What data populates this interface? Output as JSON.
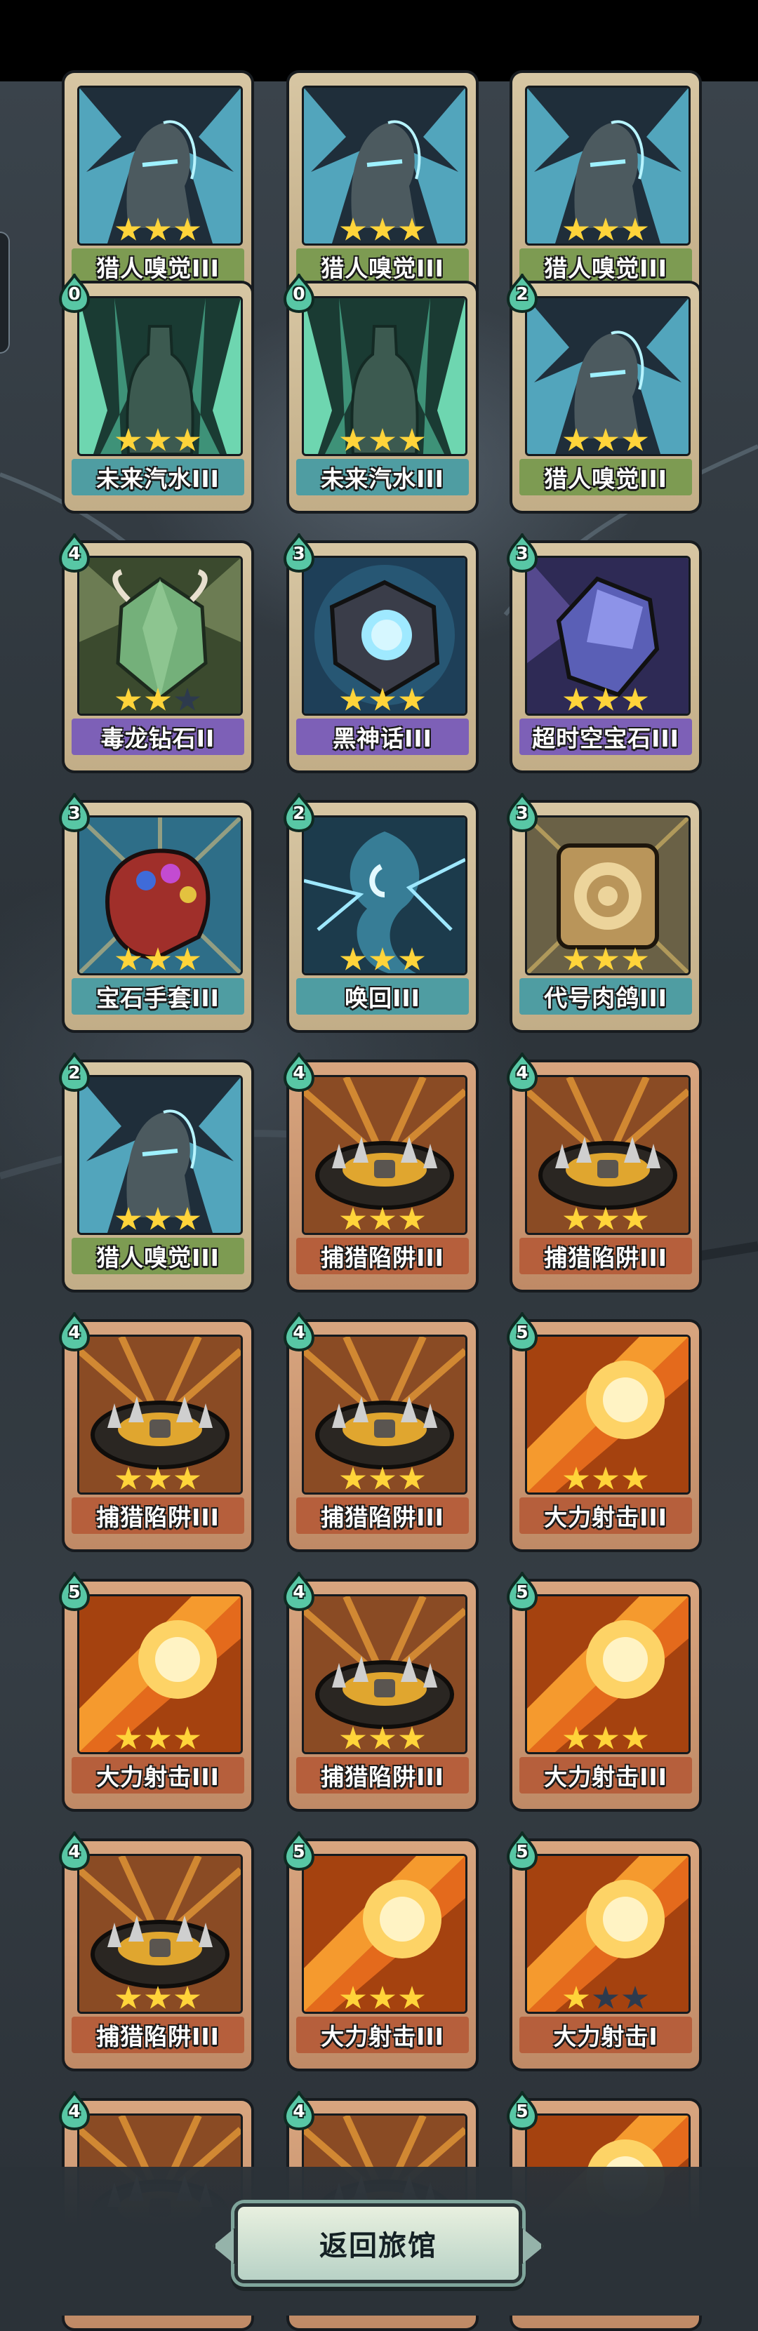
{
  "return_button": {
    "label": "返回旅馆"
  },
  "cards": [
    {
      "name": "猎人嗅觉III",
      "cost": null,
      "stars": 3,
      "theme": "green",
      "art": "hunter-icon"
    },
    {
      "name": "猎人嗅觉III",
      "cost": null,
      "stars": 3,
      "theme": "green",
      "art": "hunter-icon"
    },
    {
      "name": "猎人嗅觉III",
      "cost": null,
      "stars": 3,
      "theme": "green",
      "art": "hunter-icon"
    },
    {
      "name": "未来汽水III",
      "cost": "0",
      "stars": 3,
      "theme": "teal",
      "art": "soda-icon"
    },
    {
      "name": "未来汽水III",
      "cost": "0",
      "stars": 3,
      "theme": "teal",
      "art": "soda-icon"
    },
    {
      "name": "猎人嗅觉III",
      "cost": "2",
      "stars": 3,
      "theme": "green",
      "art": "hunter-icon"
    },
    {
      "name": "毒龙钻石II",
      "cost": "4",
      "stars": 2,
      "theme": "purple",
      "art": "dragon-gem-icon"
    },
    {
      "name": "黑神话III",
      "cost": "3",
      "stars": 3,
      "theme": "purple",
      "art": "black-myth-icon"
    },
    {
      "name": "超时空宝石III",
      "cost": "3",
      "stars": 3,
      "theme": "purple",
      "art": "time-gem-icon"
    },
    {
      "name": "宝石手套III",
      "cost": "3",
      "stars": 3,
      "theme": "teal",
      "art": "gauntlet-icon"
    },
    {
      "name": "唤回III",
      "cost": "2",
      "stars": 3,
      "theme": "teal",
      "art": "recall-icon"
    },
    {
      "name": "代号肉鸽III",
      "cost": "3",
      "stars": 3,
      "theme": "teal",
      "art": "codename-icon"
    },
    {
      "name": "猎人嗅觉III",
      "cost": "2",
      "stars": 3,
      "theme": "green",
      "art": "hunter-icon"
    },
    {
      "name": "捕猎陷阱III",
      "cost": "4",
      "stars": 3,
      "theme": "orange",
      "art": "trap-icon"
    },
    {
      "name": "捕猎陷阱III",
      "cost": "4",
      "stars": 3,
      "theme": "orange",
      "art": "trap-icon"
    },
    {
      "name": "捕猎陷阱III",
      "cost": "4",
      "stars": 3,
      "theme": "orange",
      "art": "trap-icon"
    },
    {
      "name": "捕猎陷阱III",
      "cost": "4",
      "stars": 3,
      "theme": "orange",
      "art": "trap-icon"
    },
    {
      "name": "大力射击III",
      "cost": "5",
      "stars": 3,
      "theme": "orange",
      "art": "power-shot-icon"
    },
    {
      "name": "大力射击III",
      "cost": "5",
      "stars": 3,
      "theme": "orange",
      "art": "power-shot-icon"
    },
    {
      "name": "捕猎陷阱III",
      "cost": "4",
      "stars": 3,
      "theme": "orange",
      "art": "trap-icon"
    },
    {
      "name": "大力射击III",
      "cost": "5",
      "stars": 3,
      "theme": "orange",
      "art": "power-shot-icon"
    },
    {
      "name": "捕猎陷阱III",
      "cost": "4",
      "stars": 3,
      "theme": "orange",
      "art": "trap-icon"
    },
    {
      "name": "大力射击III",
      "cost": "5",
      "stars": 3,
      "theme": "orange",
      "art": "power-shot-icon"
    },
    {
      "name": "大力射击I",
      "cost": "5",
      "stars": 1,
      "theme": "orange",
      "art": "power-shot-icon"
    },
    {
      "name": "",
      "cost": "4",
      "stars": 0,
      "theme": "orange",
      "art": "trap-icon"
    },
    {
      "name": "",
      "cost": "4",
      "stars": 0,
      "theme": "orange",
      "art": "trap-icon"
    },
    {
      "name": "",
      "cost": "5",
      "stars": 0,
      "theme": "orange",
      "art": "power-shot-icon"
    }
  ]
}
